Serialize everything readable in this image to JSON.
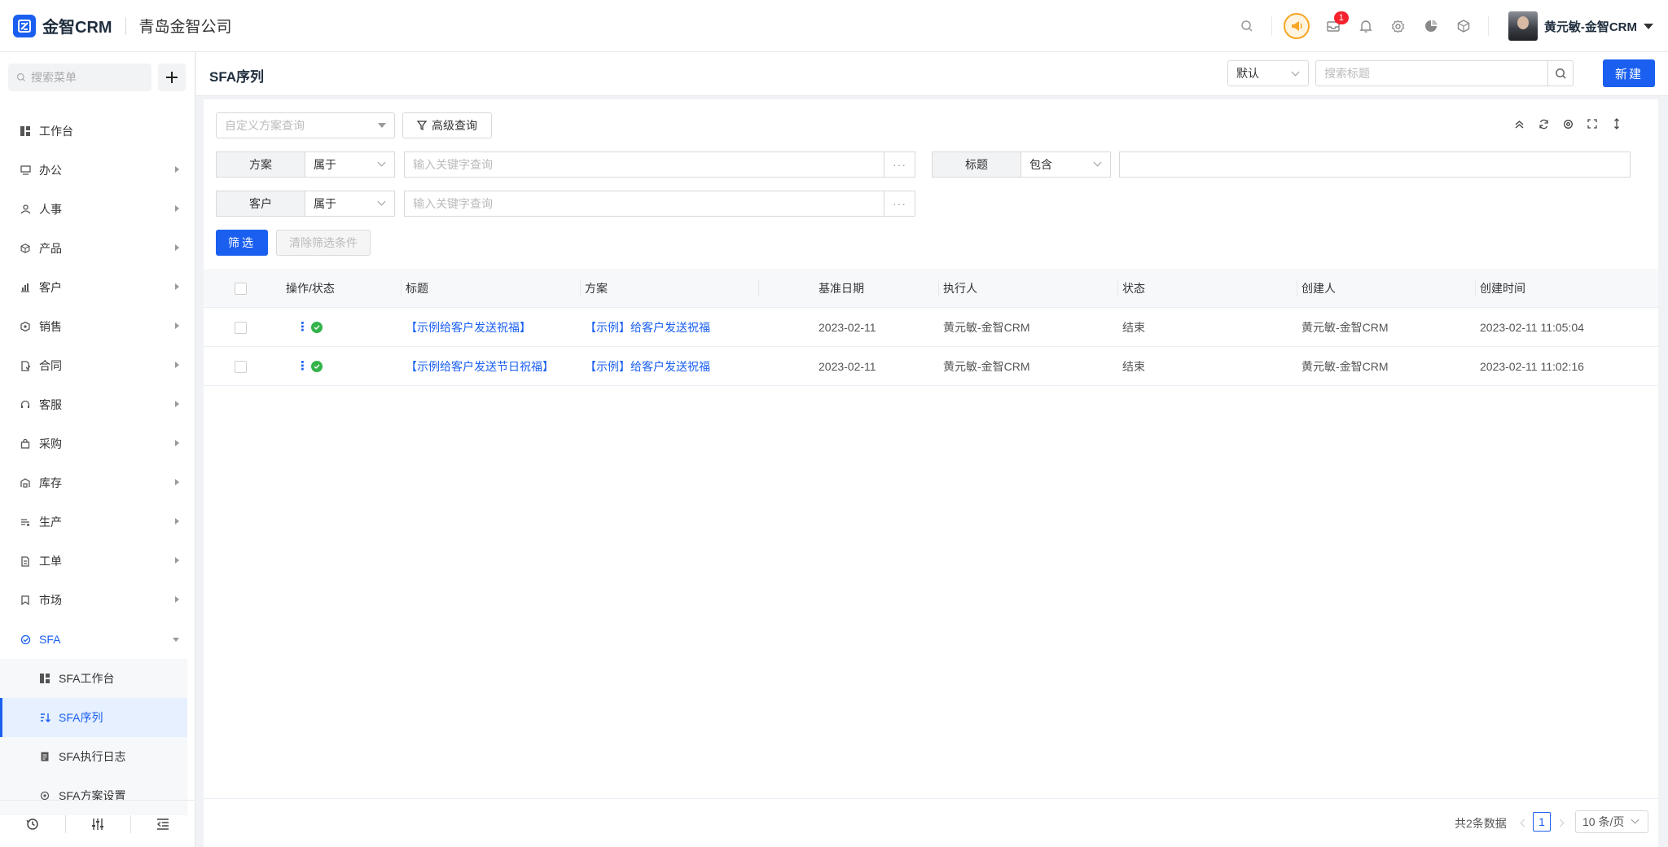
{
  "app": {
    "logo_text": "金智CRM",
    "company": "青岛金智公司",
    "brand_color": "#1a5ff0",
    "notification_count": "1",
    "user_name": "黄元敏-金智CRM"
  },
  "sidebar": {
    "search_placeholder": "搜索菜单",
    "items": [
      {
        "label": "工作台",
        "icon": "dashboard-icon"
      },
      {
        "label": "办公",
        "icon": "monitor-icon"
      },
      {
        "label": "人事",
        "icon": "people-icon"
      },
      {
        "label": "产品",
        "icon": "cube-icon"
      },
      {
        "label": "客户",
        "icon": "chart-icon"
      },
      {
        "label": "销售",
        "icon": "hexagon-icon"
      },
      {
        "label": "合同",
        "icon": "contract-icon"
      },
      {
        "label": "客服",
        "icon": "headset-icon"
      },
      {
        "label": "采购",
        "icon": "bag-icon"
      },
      {
        "label": "库存",
        "icon": "warehouse-icon"
      },
      {
        "label": "生产",
        "icon": "production-icon"
      },
      {
        "label": "工单",
        "icon": "ticket-icon"
      },
      {
        "label": "市场",
        "icon": "bookmark-icon"
      },
      {
        "label": "SFA",
        "icon": "sfa-icon"
      }
    ],
    "sfa_sub": [
      {
        "label": "SFA工作台",
        "icon": "dashboard-icon"
      },
      {
        "label": "SFA序列",
        "icon": "sort-icon"
      },
      {
        "label": "SFA执行日志",
        "icon": "log-icon"
      },
      {
        "label": "SFA方案设置",
        "icon": "settings-icon"
      }
    ]
  },
  "header": {
    "title": "SFA序列",
    "view_select": "默认",
    "search_placeholder": "搜索标题",
    "new_label": "新建"
  },
  "filters": {
    "custom_query_placeholder": "自定义方案查询",
    "advanced_label": "高级查询",
    "plan_label": "方案",
    "plan_op": "属于",
    "plan_placeholder": "输入关键字查询",
    "title_label": "标题",
    "title_op": "包含",
    "customer_label": "客户",
    "customer_op": "属于",
    "customer_placeholder": "输入关键字查询",
    "more": "···",
    "filter_btn": "筛选",
    "clear_btn": "清除筛选条件"
  },
  "table": {
    "columns": [
      "操作/状态",
      "标题",
      "方案",
      "基准日期",
      "执行人",
      "状态",
      "创建人",
      "创建时间"
    ],
    "rows": [
      {
        "title": "【示例给客户发送祝福】",
        "plan": "【示例】给客户发送祝福",
        "base_date": "2023-02-11",
        "executor": "黄元敏-金智CRM",
        "status": "结束",
        "creator": "黄元敏-金智CRM",
        "created_at": "2023-02-11 11:05:04"
      },
      {
        "title": "【示例给客户发送节日祝福】",
        "plan": "【示例】给客户发送祝福",
        "base_date": "2023-02-11",
        "executor": "黄元敏-金智CRM",
        "status": "结束",
        "creator": "黄元敏-金智CRM",
        "created_at": "2023-02-11 11:02:16"
      }
    ]
  },
  "pagination": {
    "total": "共2条数据",
    "current_page": "1",
    "page_size": "10 条/页"
  }
}
